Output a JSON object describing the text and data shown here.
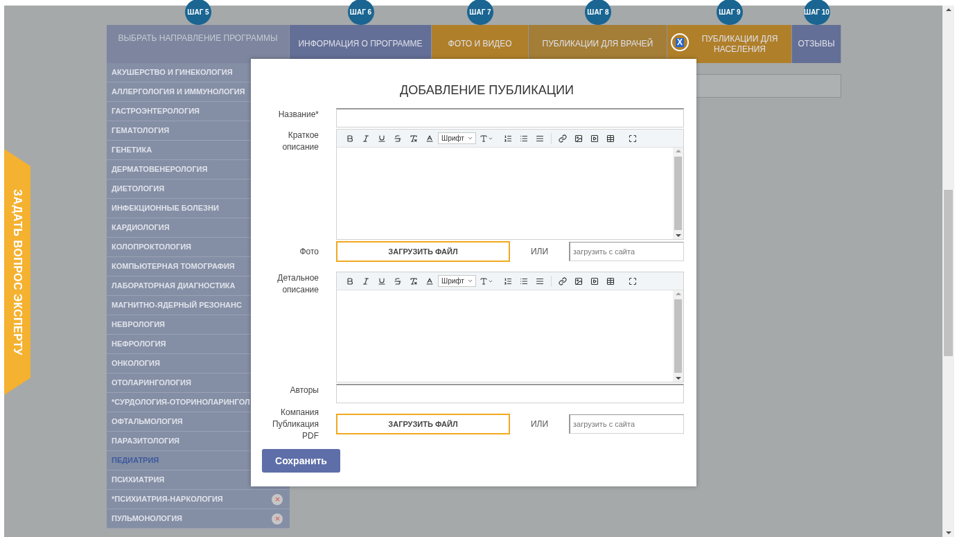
{
  "ask_tab": "ЗАДАТЬ ВОПРОС ЭКСПЕРТУ",
  "steps": [
    {
      "step": "ШАГ 5",
      "label": "ВЫБРАТЬ НАПРАВЛЕНИЕ ПРОГРАММЫ",
      "color": "#7d869e"
    },
    {
      "step": "ШАГ 6",
      "label": "ИНФОРМАЦИЯ О ПРОГРАММЕ",
      "color": "#646f97"
    },
    {
      "step": "ШАГ 7",
      "label": "ФОТО И ВИДЕО",
      "color": "#b07f2a"
    },
    {
      "step": "ШАГ 8",
      "label": "ПУБЛИКАЦИИ ДЛЯ ВРАЧЕЙ",
      "color": "#a47d36"
    },
    {
      "step": "ШАГ 9",
      "label": "ПУБЛИКАЦИИ ДЛЯ НАСЕЛЕНИЯ",
      "color": "#b07f2a"
    },
    {
      "step": "ШАГ 10",
      "label": "ОТЗЫВЫ",
      "color": "#646f97"
    }
  ],
  "sidebar": {
    "items": [
      {
        "label": "АКУШЕРСТВО И ГИНЕКОЛОГИЯ",
        "selected": false
      },
      {
        "label": "АЛЛЕРГОЛОГИЯ И ИММУНОЛОГИЯ",
        "selected": false
      },
      {
        "label": "ГАСТРОЭНТЕРОЛОГИЯ",
        "selected": false
      },
      {
        "label": "ГЕМАТОЛОГИЯ",
        "selected": false
      },
      {
        "label": "ГЕНЕТИКА",
        "selected": false
      },
      {
        "label": "ДЕРМАТОВЕНЕРОЛОГИЯ",
        "selected": false
      },
      {
        "label": "ДИЕТОЛОГИЯ",
        "selected": false
      },
      {
        "label": "ИНФЕКЦИОННЫЕ БОЛЕЗНИ",
        "selected": false
      },
      {
        "label": "КАРДИОЛОГИЯ",
        "selected": false
      },
      {
        "label": "КОЛОПРОКТОЛОГИЯ",
        "selected": false
      },
      {
        "label": "КОМПЬЮТЕРНАЯ ТОМОГРАФИЯ",
        "selected": false
      },
      {
        "label": "ЛАБОРАТОРНАЯ ДИАГНОСТИКА",
        "selected": false
      },
      {
        "label": "МАГНИТНО-ЯДЕРНЫЙ РЕЗОНАНС",
        "selected": false
      },
      {
        "label": "НЕВРОЛОГИЯ",
        "selected": false
      },
      {
        "label": "НЕФРОЛОГИЯ",
        "selected": false
      },
      {
        "label": "ОНКОЛОГИЯ",
        "selected": false
      },
      {
        "label": "ОТОЛАРИНГОЛОГИЯ",
        "selected": false
      },
      {
        "label": "*СУРДОЛОГИЯ-ОТОРИНОЛАРИНГОЛ",
        "selected": false
      },
      {
        "label": "ОФТАЛЬМОЛОГИЯ",
        "selected": false
      },
      {
        "label": "ПАРАЗИТОЛОГИЯ",
        "selected": false
      },
      {
        "label": "ПЕДИАТРИЯ",
        "selected": true
      },
      {
        "label": "ПСИХИАТРИЯ",
        "selected": false
      },
      {
        "label": "*ПСИХИАТРИЯ-НАРКОЛОГИЯ",
        "selected": false
      },
      {
        "label": "ПУЛЬМОНОЛОГИЯ",
        "selected": false
      }
    ]
  },
  "modal": {
    "close": "X",
    "title": "ДОБАВЛЕНИЕ ПУБЛИКАЦИИ",
    "fields": [
      {
        "kind": "text",
        "label": "Название*"
      },
      {
        "kind": "editor",
        "label": "Краткое описание",
        "font_select": "Шрифт"
      },
      {
        "kind": "upload",
        "label": "Фото",
        "button": "ЗАГРУЗИТЬ ФАЙЛ",
        "or": "ИЛИ",
        "placeholder": "загрузить с сайта"
      },
      {
        "kind": "editor",
        "label": "Детальное описание",
        "font_select": "Шрифт"
      },
      {
        "kind": "text",
        "label": "Авторы"
      },
      {
        "kind": "upload",
        "label": "Компания Публикация PDF",
        "button": "ЗАГРУЗИТЬ ФАЙЛ",
        "or": "ИЛИ",
        "placeholder": "загрузить с сайта"
      }
    ],
    "save": "Сохранить"
  }
}
